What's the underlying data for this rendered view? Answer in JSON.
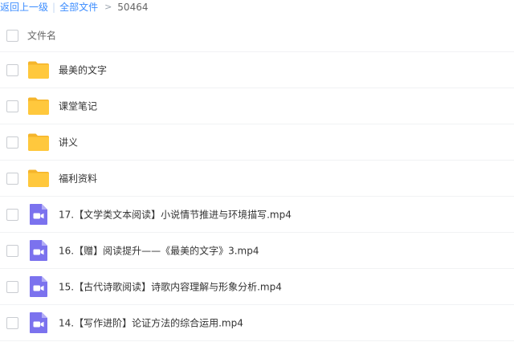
{
  "breadcrumb": {
    "back": "返回上一级",
    "separator": "|",
    "all_files": "全部文件",
    "arrow": ">",
    "current": "50464"
  },
  "list_header": {
    "column_label": "文件名"
  },
  "files": [
    {
      "name": "最美的文字",
      "type": "folder"
    },
    {
      "name": "课堂笔记",
      "type": "folder"
    },
    {
      "name": "讲义",
      "type": "folder"
    },
    {
      "name": "福利资料",
      "type": "folder"
    },
    {
      "name": "17.【文学类文本阅读】小说情节推进与环境描写.mp4",
      "type": "video"
    },
    {
      "name": "16.【赠】阅读提升——《最美的文字》3.mp4",
      "type": "video"
    },
    {
      "name": "15.【古代诗歌阅读】诗歌内容理解与形象分析.mp4",
      "type": "video"
    },
    {
      "name": "14.【写作进阶】论证方法的综合运用.mp4",
      "type": "video"
    }
  ],
  "colors": {
    "link": "#3b8cff",
    "folder": "#ffc83d",
    "folder_tab": "#f5b52b",
    "video": "#7b72ee"
  },
  "icons": {
    "folder": "folder-icon",
    "video": "video-file-icon"
  }
}
